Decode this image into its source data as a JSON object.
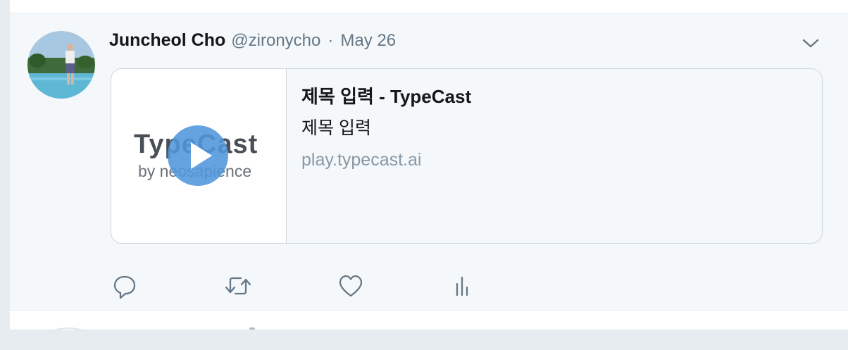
{
  "tweet": {
    "author_name": "Juncheol Cho",
    "handle": "@zironycho",
    "separator": "·",
    "date": "May 26"
  },
  "card": {
    "title": "제목 입력 - TypeCast",
    "description": "제목 입력",
    "domain": "play.typecast.ai",
    "thumbnail": {
      "logo_text": "TypeCast",
      "tagline": "by neosapience",
      "overlay_icon": "play-icon"
    }
  },
  "actions": [
    {
      "name": "reply",
      "icon": "reply-icon"
    },
    {
      "name": "retweet",
      "icon": "retweet-icon"
    },
    {
      "name": "like",
      "icon": "heart-icon"
    },
    {
      "name": "analytics",
      "icon": "analytics-icon"
    }
  ],
  "colors": {
    "text_primary": "#14171a",
    "text_secondary": "#657786",
    "border": "#ccd6dd",
    "play_overlay": "#5096dc",
    "tweet_background": "#f5f8fa"
  }
}
